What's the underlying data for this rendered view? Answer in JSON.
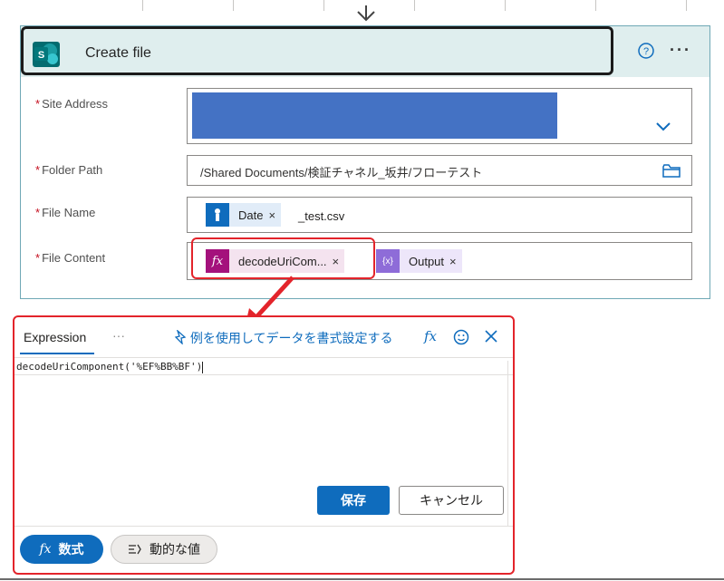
{
  "action": {
    "title": "Create file",
    "icons": {
      "app": "sharepoint-icon",
      "help": "help-icon",
      "more": "more-icon",
      "flow": "arrow-down-icon"
    },
    "more_label": "···"
  },
  "fields": {
    "site_address": {
      "label": "Site Address",
      "required_mark": "*"
    },
    "folder_path": {
      "label": "Folder Path",
      "required_mark": "*",
      "value": "/Shared Documents/検証チャネル_坂井/フローテスト"
    },
    "file_name": {
      "label": "File Name",
      "required_mark": "*",
      "token_label": "Date",
      "token_close": "×",
      "suffix": "_test.csv"
    },
    "file_content": {
      "label": "File Content",
      "required_mark": "*",
      "tokens": [
        {
          "label": "decodeUriCom...",
          "close": "×",
          "icon_text": "fx"
        },
        {
          "label": "Output",
          "close": "×",
          "icon_text": "{x}"
        }
      ]
    }
  },
  "expression_panel": {
    "tab_label": "Expression",
    "tab_more": "···",
    "format_link": "例を使用してデータを書式設定する",
    "fx_label": "fx",
    "code": "decodeUriComponent('%EF%BB%BF')",
    "save_label": "保存",
    "cancel_label": "キャンセル",
    "formula_label": "数式",
    "formula_icon": "fx",
    "dynamic_label": "動的な値"
  },
  "colors": {
    "accent": "#0f6cbd",
    "header_bg": "#dfeeee",
    "highlight": "#e3242b",
    "redacted": "#4472c4",
    "expression_token": "#a4117c",
    "variable_token": "#8e6cd8",
    "trigger_token": "#0f6cbd"
  }
}
